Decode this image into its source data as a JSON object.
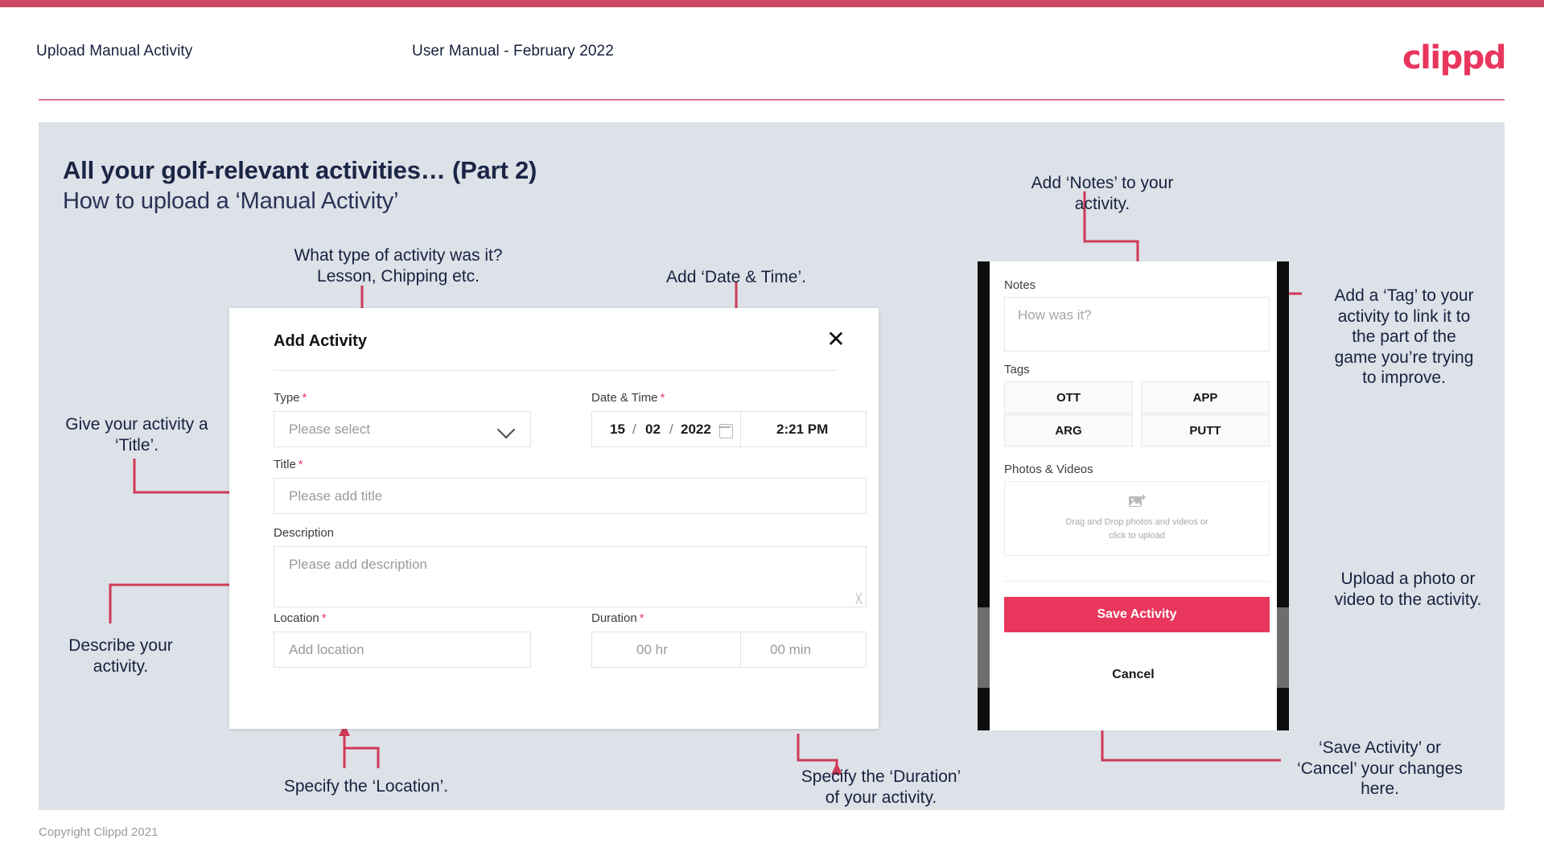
{
  "header": {
    "left_title": "Upload Manual Activity",
    "center_title": "User Manual - February 2022",
    "logo": "clippd",
    "brand_color": "#e8365d"
  },
  "slide": {
    "heading": "All your golf-relevant activities… (Part 2)",
    "subheading": "How to upload a ‘Manual Activity’",
    "background": "#dde1e8"
  },
  "annotations": {
    "type": "What type of activity was it?\nLesson, Chipping etc.",
    "type_line1": "What type of activity was it?",
    "type_line2": "Lesson, Chipping etc.",
    "datetime": "Add ‘Date & Time’.",
    "title": "Give your activity a\n‘Title’.",
    "title_line1": "Give your activity a",
    "title_line2": "‘Title’.",
    "describe_line1": "Describe your",
    "describe_line2": "activity.",
    "location": "Specify the ‘Location’.",
    "duration_line1": "Specify the ‘Duration’",
    "duration_line2": "of your activity.",
    "notes_line1": "Add ‘Notes’ to your",
    "notes_line2": "activity.",
    "tag_line1": "Add a ‘Tag’ to your",
    "tag_line2": "activity to link it to",
    "tag_line3": "the part of the",
    "tag_line4": "game you’re trying",
    "tag_line5": "to improve.",
    "upload_line1": "Upload a photo or",
    "upload_line2": "video to the activity.",
    "save_line1": "‘Save Activity’ or",
    "save_line2": "‘Cancel’ your changes",
    "save_line3": "here."
  },
  "dialog": {
    "title": "Add Activity",
    "close_icon": "close-icon",
    "fields": {
      "type": {
        "label": "Type",
        "required": "*",
        "placeholder": "Please select",
        "icon": "chevron-down-icon"
      },
      "datetime": {
        "label": "Date & Time",
        "required": "*",
        "day": "15",
        "sep1": "/",
        "month": "02",
        "sep2": "/",
        "year": "2022",
        "icon": "calendar-icon",
        "time": "2:21 PM"
      },
      "title": {
        "label": "Title",
        "required": "*",
        "placeholder": "Please add title"
      },
      "description": {
        "label": "Description",
        "required": "",
        "placeholder": "Please add description"
      },
      "location": {
        "label": "Location",
        "required": "*",
        "placeholder": "Add location"
      },
      "duration": {
        "label": "Duration",
        "required": "*",
        "hours_placeholder": "00 hr",
        "minutes_placeholder": "00 min"
      }
    }
  },
  "phone": {
    "notes": {
      "label": "Notes",
      "placeholder": "How was it?"
    },
    "tags": {
      "label": "Tags",
      "items": [
        "OTT",
        "APP",
        "ARG",
        "PUTT"
      ]
    },
    "photos": {
      "label": "Photos & Videos",
      "icon": "add-image-icon",
      "drop_line1": "Drag and Drop photos and videos or",
      "drop_line2": "click to upload"
    },
    "save_label": "Save Activity",
    "cancel_label": "Cancel"
  },
  "footer": {
    "copyright": "Copyright Clippd 2021"
  }
}
